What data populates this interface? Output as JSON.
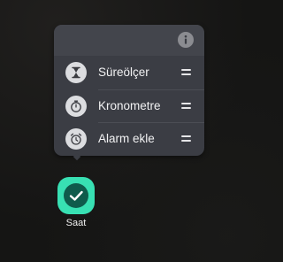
{
  "popup": {
    "header": {
      "info_icon": "info-icon"
    },
    "items": [
      {
        "label": "Süreölçer",
        "icon": "hourglass-icon"
      },
      {
        "label": "Kronometre",
        "icon": "stopwatch-icon"
      },
      {
        "label": "Alarm ekle",
        "icon": "alarm-clock-icon"
      }
    ]
  },
  "app": {
    "label": "Saat",
    "icon": "clock-app-icon",
    "color": "#38e0b3"
  }
}
